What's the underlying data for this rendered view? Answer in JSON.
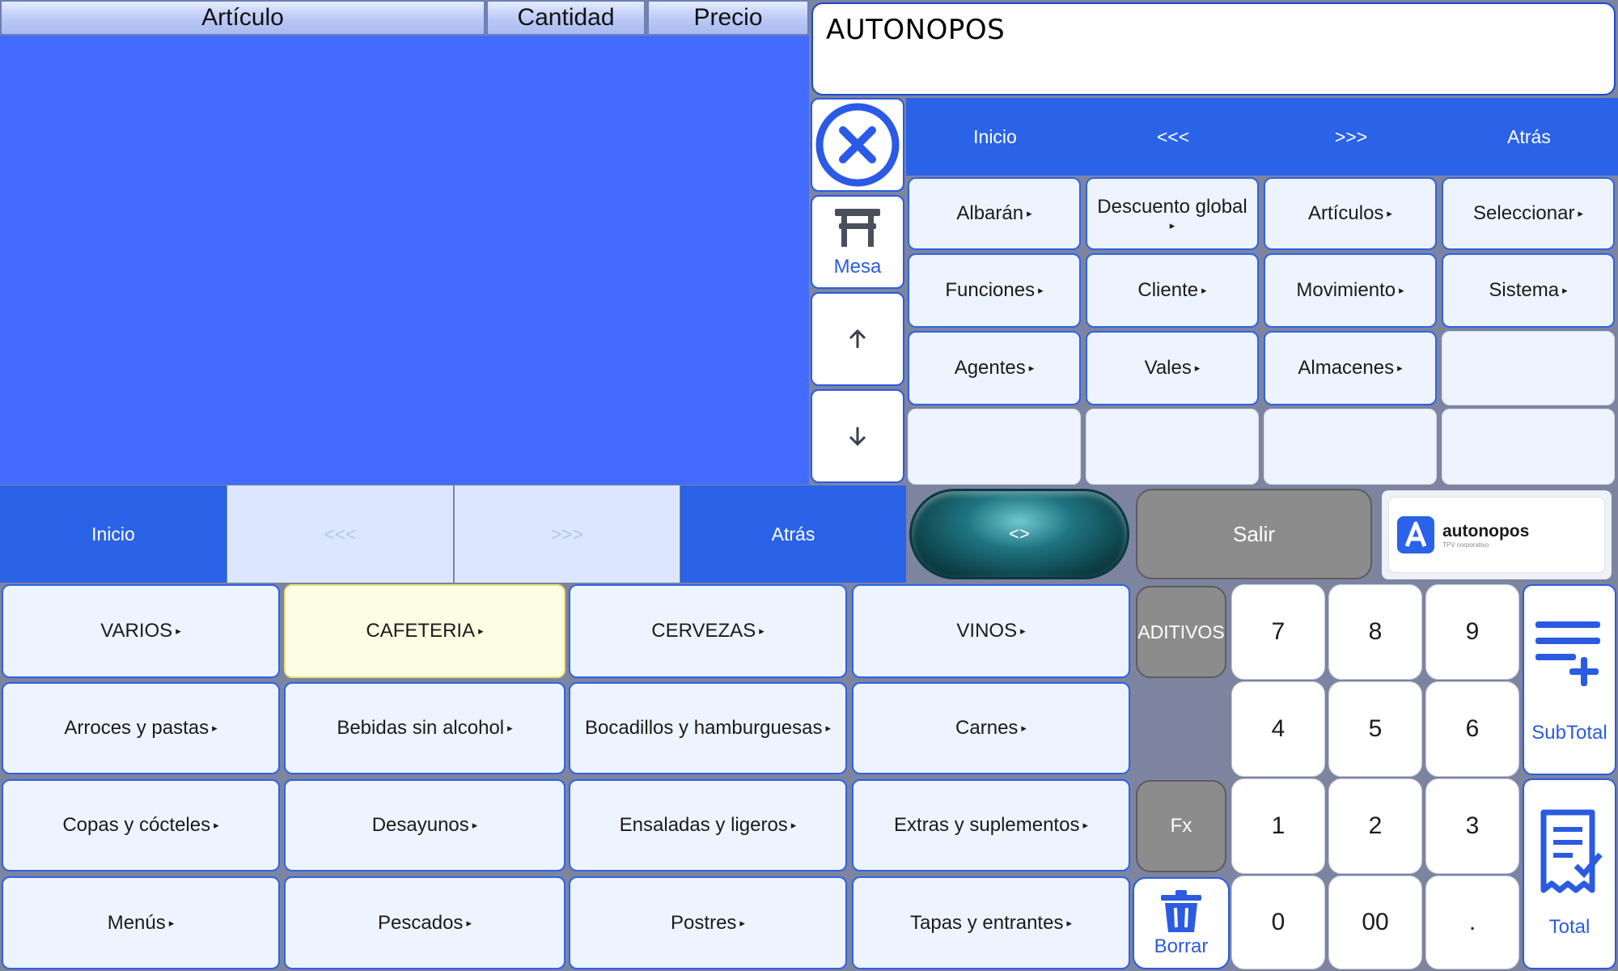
{
  "columns": [
    "Artículo",
    "Cantidad",
    "Precio"
  ],
  "display": {
    "text": "AUTONOPOS"
  },
  "side_buttons": {
    "mesa": "Mesa"
  },
  "func_nav": [
    "Inicio",
    "<<<",
    ">>>",
    "Atrás"
  ],
  "func_buttons": [
    {
      "label": "Albarán"
    },
    {
      "label": "Descuento global"
    },
    {
      "label": "Artículos"
    },
    {
      "label": "Seleccionar"
    },
    {
      "label": "Funciones"
    },
    {
      "label": "Cliente"
    },
    {
      "label": "Movimiento"
    },
    {
      "label": "Sistema"
    },
    {
      "label": "Agentes"
    },
    {
      "label": "Vales"
    },
    {
      "label": "Almacenes"
    }
  ],
  "cat_nav": [
    "Inicio",
    "<<<",
    ">>>",
    "Atrás"
  ],
  "toggle_label": "<>",
  "exit_label": "Salir",
  "logo": {
    "name": "autonopos",
    "tagline": "TPV corporativo"
  },
  "categories": [
    "VARIOS",
    "CAFETERIA",
    "CERVEZAS",
    "VINOS",
    "Arroces y pastas",
    "Bebidas sin alcohol",
    "Bocadillos y hamburguesas",
    "Carnes",
    "Copas y cócteles",
    "Desayunos",
    "Ensaladas y ligeros",
    "Extras y suplementos",
    "Menús",
    "Pescados",
    "Postres",
    "Tapas y entrantes"
  ],
  "keypad": {
    "aditivos": "ADITIVOS",
    "fx": "Fx",
    "borrar": "Borrar",
    "keys": [
      "7",
      "8",
      "9",
      "4",
      "5",
      "6",
      "1",
      "2",
      "3",
      "0",
      "00",
      "."
    ],
    "subtotal": "SubTotal",
    "total": "Total"
  },
  "colors": {
    "ticket_bg": "#436cff",
    "nav_blue": "#2a62e8",
    "accent": "#2e63e6",
    "selected_cat": "#fdfde4"
  }
}
